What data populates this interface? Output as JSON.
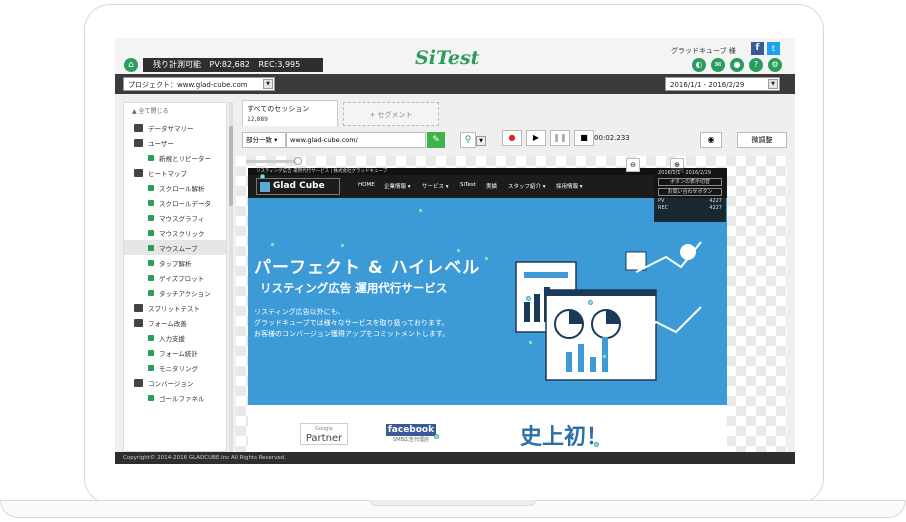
{
  "header": {
    "status_label": "残り計測可能",
    "pv": "PV:82,682",
    "rec": "REC:3,995",
    "logo": "SiTest",
    "user": "グラッドキューブ 様",
    "icons": [
      "home-icon",
      "toggle-icon",
      "chat-icon",
      "user-icon",
      "help-icon",
      "gear-icon"
    ]
  },
  "toolbar": {
    "project": "プロジェクト：www.glad-cube.com",
    "date_range": "2016/1/1 - 2016/2/29"
  },
  "sidebar": {
    "collapse_all": "▲ 全て閉じる",
    "items": [
      {
        "label": "データサマリー",
        "level": 1
      },
      {
        "label": "ユーザー",
        "level": 1
      },
      {
        "label": "新規とリピーター",
        "level": 2
      },
      {
        "label": "ヒートマップ",
        "level": 1
      },
      {
        "label": "スクロール解析",
        "level": 2
      },
      {
        "label": "スクロールデータ",
        "level": 2
      },
      {
        "label": "マウスグラフィ",
        "level": 2
      },
      {
        "label": "マウスクリック",
        "level": 2
      },
      {
        "label": "マウスムーブ",
        "level": 2,
        "active": true
      },
      {
        "label": "タップ解析",
        "level": 2
      },
      {
        "label": "ゲイズプロット",
        "level": 2
      },
      {
        "label": "タッチアクション",
        "level": 2
      },
      {
        "label": "スプリットテスト",
        "level": 1
      },
      {
        "label": "フォーム改善",
        "level": 1
      },
      {
        "label": "入力支援",
        "level": 2
      },
      {
        "label": "フォーム統計",
        "level": 2
      },
      {
        "label": "モニタリング",
        "level": 2
      },
      {
        "label": "コンバージョン",
        "level": 1
      },
      {
        "label": "ゴールファネル",
        "level": 2
      }
    ]
  },
  "session": {
    "tab_label": "すべてのセッション",
    "count": "12,889",
    "add_segment": "+ セグメント"
  },
  "url_bar": {
    "match_type": "部分一致 ▾",
    "url": "www.glad-cube.com/"
  },
  "player": {
    "time": "00:02.233"
  },
  "adjust_label": "微調整",
  "site": {
    "title_bar": "リスティング広告 運用代行サービス | 株式会社グラッドキューブ",
    "logo": "Glad Cube",
    "nav": [
      "HOME",
      "企業情報 ▾",
      "サービス ▾",
      "SiTest",
      "実績",
      "スタッフ紹介 ▾",
      "採用情報 ▾"
    ],
    "headline": "パーフェクト & ハイレベル",
    "subheadline": "リスティング広告 運用代行サービス",
    "body": [
      "リスティング広告以外にも、",
      "グラッドキューブでは様々なサービスを取り扱っております。",
      "お客様のコンバージョン獲得アップをコミットメントします。"
    ],
    "google_partner": {
      "small": "Google",
      "big": "Partner"
    },
    "facebook": {
      "big": "facebook",
      "small": "SMB広告代理店"
    },
    "first_ever": "史上初！"
  },
  "overlay": {
    "date": "2016/1/1 - 2016/2/29",
    "btn1": "ボタンの表示切替",
    "btn2": "お問い合わせボタン",
    "pv_label": "PV",
    "pv": "4227",
    "rec_label": "REC",
    "rec": "4227"
  },
  "footer": "Copyright© 2014-2016 GLADCUBE.Inc All Rights Reserved.",
  "colors": {
    "brand": "#2a9d5c",
    "hero": "#3c9ad6",
    "dark": "#2e2e2e"
  }
}
